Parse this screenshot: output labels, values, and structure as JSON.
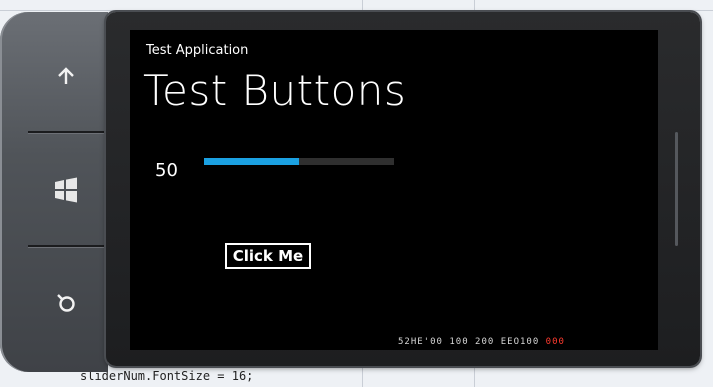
{
  "background": {
    "code_snippet": "sliderNum.FontSize = 16;"
  },
  "hardware": {
    "back_icon": "arrow-up-icon",
    "start_icon": "windows-logo-icon",
    "search_icon": "search-icon"
  },
  "app": {
    "application_title": "Test Application",
    "page_title": "Test Buttons"
  },
  "slider": {
    "value_label": "50",
    "value": 50,
    "max": 100,
    "accent_color": "#1ba1e2",
    "track_color": "#2f2f2f"
  },
  "button": {
    "label": "Click Me"
  },
  "frame_counter": {
    "segments": [
      "52HE'00",
      "100",
      "200",
      "EEO100"
    ],
    "alert_segment": "000",
    "alert_color": "#ff3b2f"
  }
}
